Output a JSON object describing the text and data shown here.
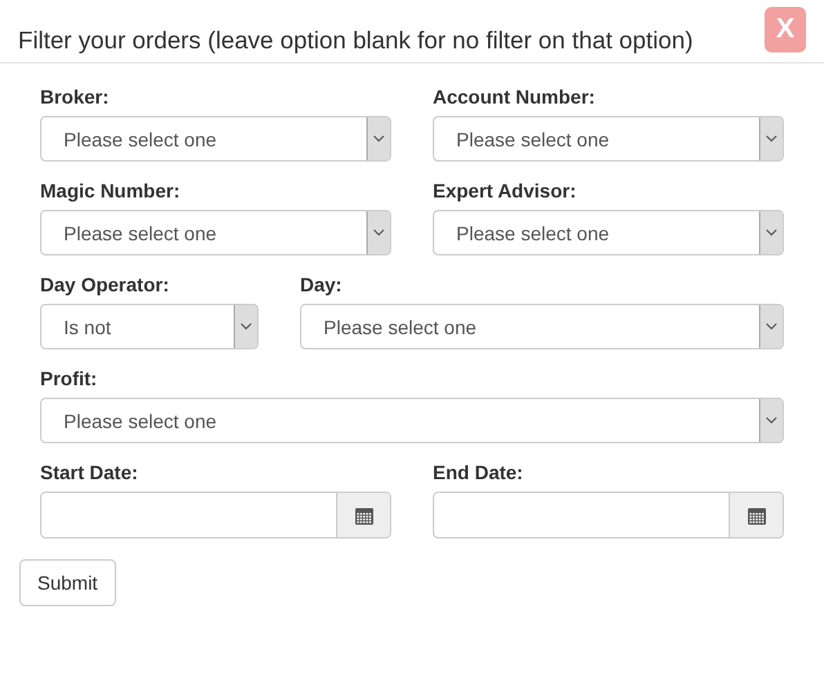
{
  "title": "Filter your orders (leave option blank for no filter on that option)",
  "close": "X",
  "rows": [
    {
      "kind": "pair",
      "fields": [
        {
          "kind": "select",
          "label": "Broker:",
          "value": "Please select one"
        },
        {
          "kind": "select",
          "label": "Account Number:",
          "value": "Please select one"
        }
      ]
    },
    {
      "kind": "pair",
      "fields": [
        {
          "kind": "select",
          "label": "Magic Number:",
          "value": "Please select one"
        },
        {
          "kind": "select",
          "label": "Expert Advisor:",
          "value": "Please select one"
        }
      ]
    },
    {
      "kind": "operator",
      "fields": [
        {
          "kind": "select",
          "label": "Day Operator:",
          "value": "Is not"
        },
        {
          "kind": "select",
          "label": "Day:",
          "value": "Please select one"
        }
      ]
    },
    {
      "kind": "single",
      "fields": [
        {
          "kind": "select",
          "label": "Profit:",
          "value": "Please select one"
        }
      ]
    },
    {
      "kind": "pair",
      "fields": [
        {
          "kind": "date",
          "label": "Start Date:"
        },
        {
          "kind": "date",
          "label": "End Date:"
        }
      ]
    }
  ],
  "submit": "Submit"
}
